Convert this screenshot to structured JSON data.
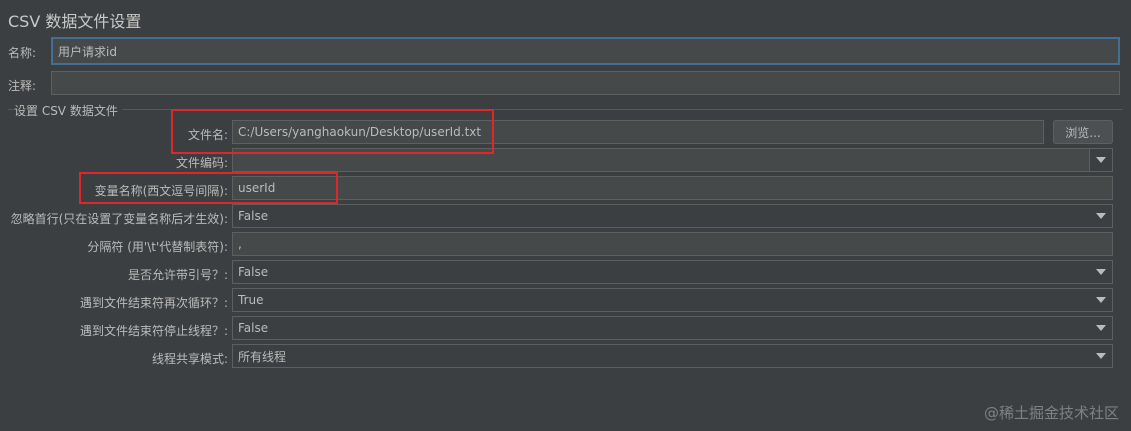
{
  "title": "CSV 数据文件设置",
  "name_label": "名称:",
  "name_value": "用户请求id",
  "comment_label": "注释:",
  "comment_value": "",
  "group_title": "设置 CSV 数据文件",
  "fields": {
    "filename": {
      "label": "文件名:",
      "value": "C:/Users/yanghaokun/Desktop/userId.txt"
    },
    "browse_button": "浏览...",
    "encoding": {
      "label": "文件编码:",
      "value": ""
    },
    "variable_names": {
      "label": "变量名称(西文逗号间隔):",
      "value": "userId"
    },
    "ignore_first_line": {
      "label": "忽略首行(只在设置了变量名称后才生效):",
      "value": "False"
    },
    "delimiter": {
      "label": "分隔符 (用'\\t'代替制表符):",
      "value": ","
    },
    "allow_quoted": {
      "label": "是否允许带引号？:",
      "value": "False"
    },
    "recycle_eof": {
      "label": "遇到文件结束符再次循环？:",
      "value": "True"
    },
    "stop_thread_eof": {
      "label": "遇到文件结束符停止线程？:",
      "value": "False"
    },
    "sharing_mode": {
      "label": "线程共享模式:",
      "value": "所有线程"
    }
  },
  "icons": {
    "dropdown": "chevron-down-icon"
  },
  "colors": {
    "background": "#3c3f41",
    "field_bg": "#45494a",
    "highlight": "#e0262b",
    "focus_border": "#466d94"
  },
  "watermark": "@稀土掘金技术社区"
}
